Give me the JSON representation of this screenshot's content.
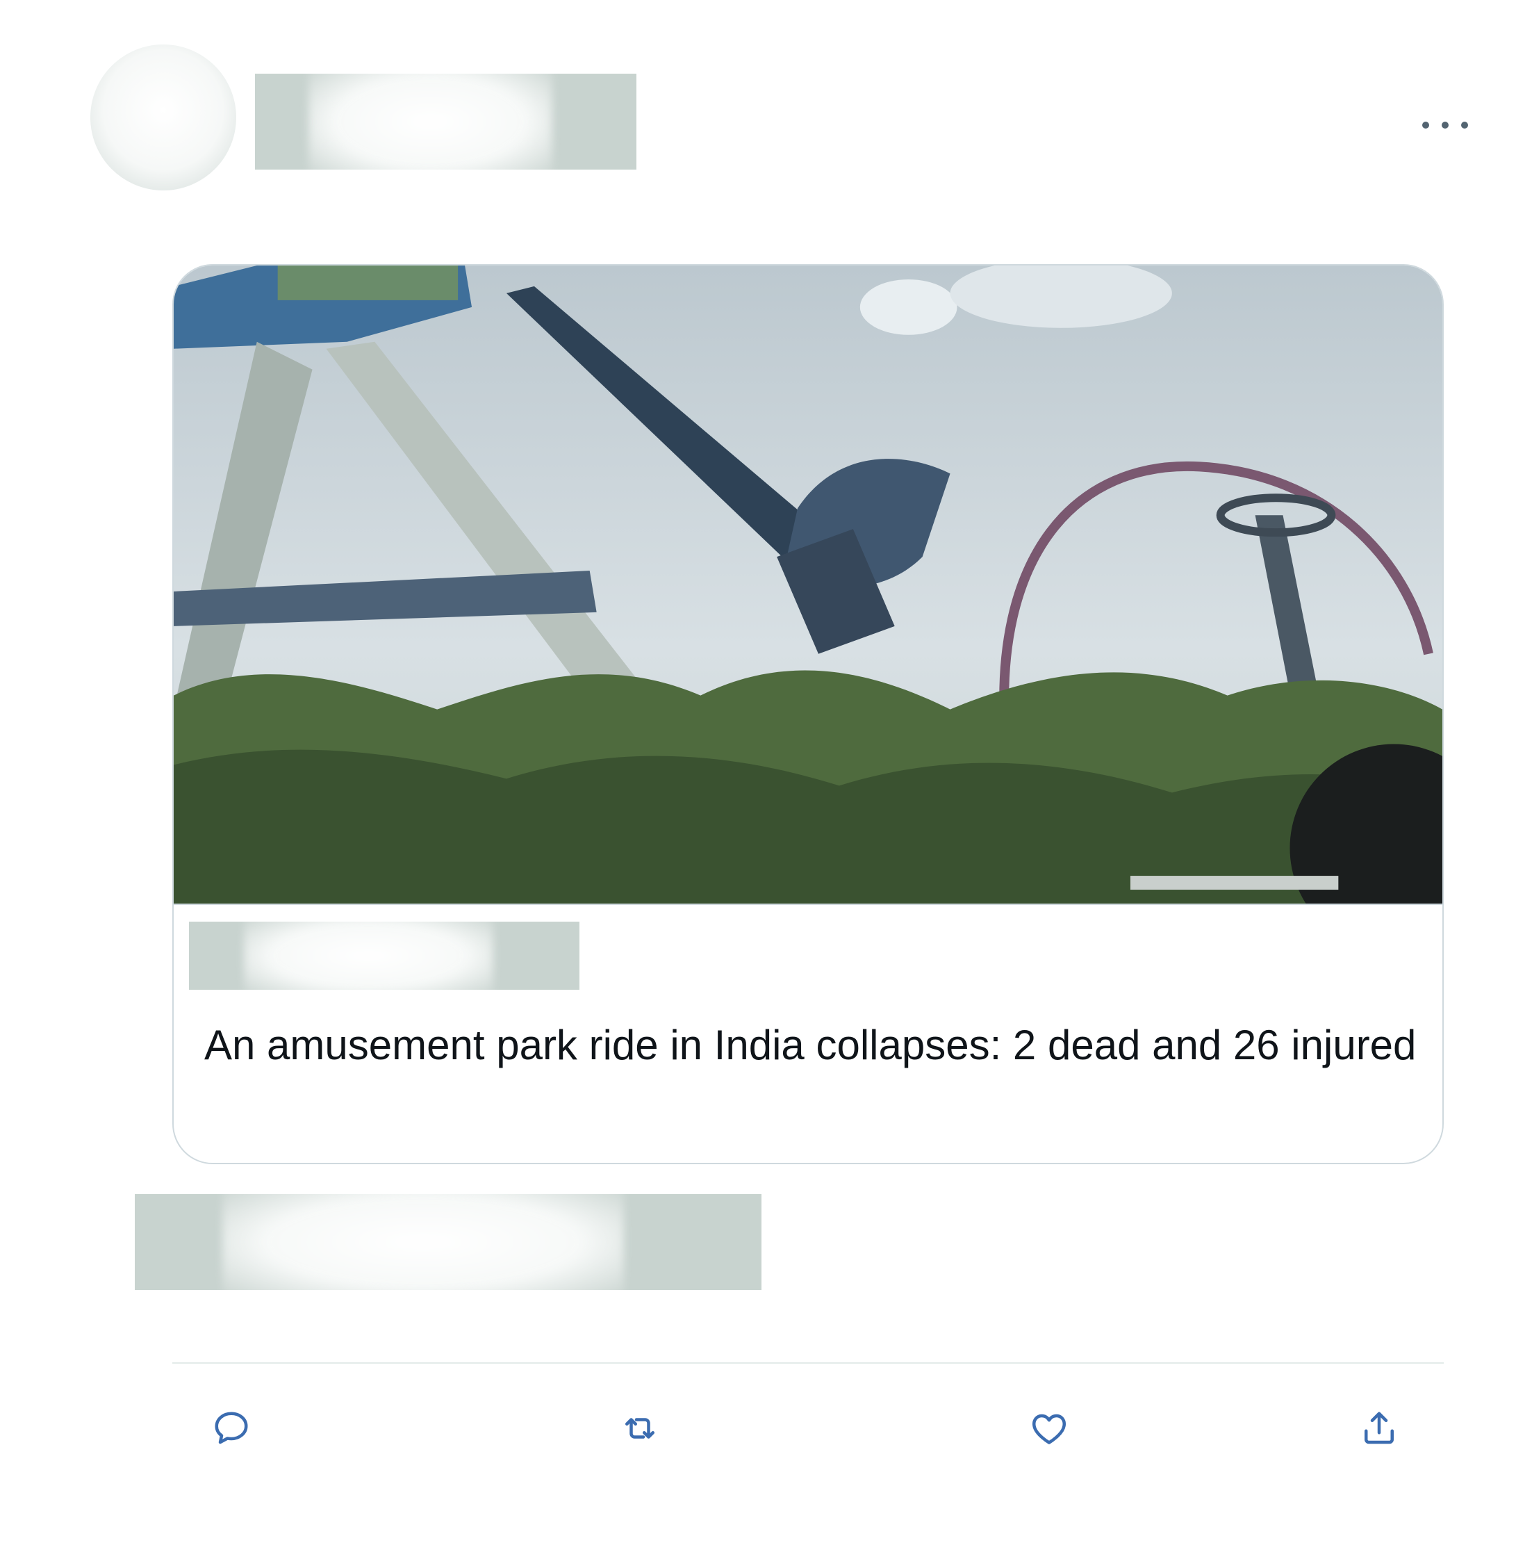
{
  "tweet": {
    "card": {
      "title": "An amusement park ride in India collapses: 2 dead and 26 injured"
    },
    "more_icon": "more-horizontal-icon",
    "actions": [
      {
        "name": "reply",
        "icon": "reply-icon"
      },
      {
        "name": "retweet",
        "icon": "retweet-icon"
      },
      {
        "name": "like",
        "icon": "heart-icon"
      },
      {
        "name": "share",
        "icon": "share-icon"
      }
    ],
    "colors": {
      "text": "#0f1419",
      "icon": "#536471",
      "action_icon": "#3b6cb0",
      "border": "#cfd9de",
      "redaction": "#c8d3cf"
    }
  }
}
